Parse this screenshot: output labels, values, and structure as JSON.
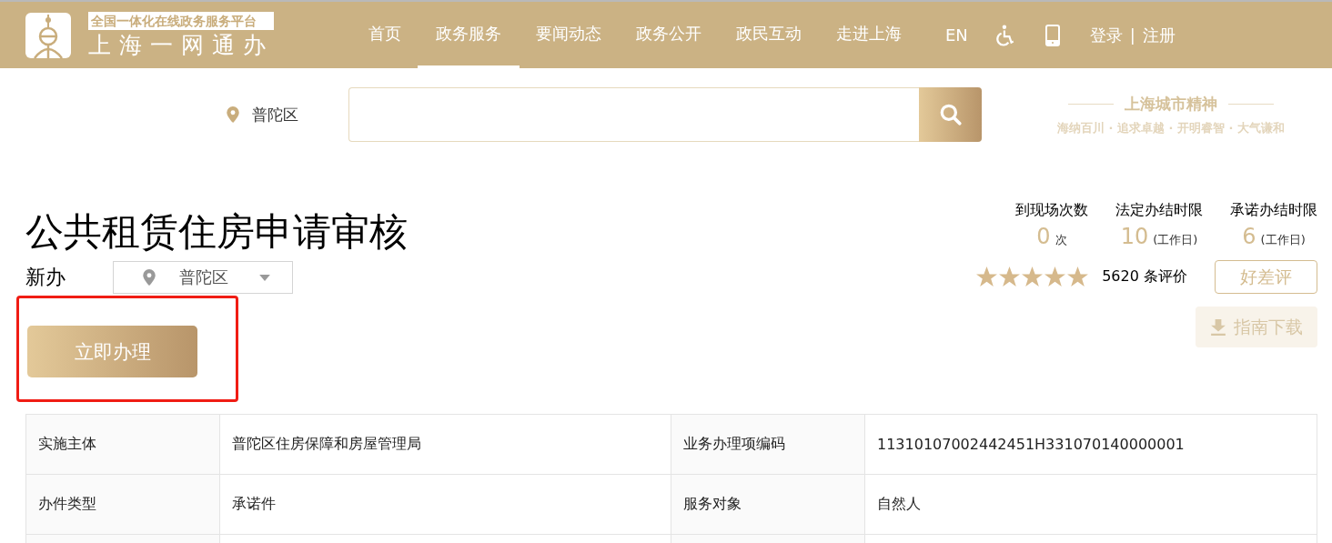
{
  "header": {
    "logo_tagline": "全国一体化在线政务服务平台",
    "logo_title": "上海一网通办",
    "nav": [
      {
        "label": "首页",
        "selected": false
      },
      {
        "label": "政务服务",
        "selected": true
      },
      {
        "label": "要闻动态",
        "selected": false
      },
      {
        "label": "政务公开",
        "selected": false
      },
      {
        "label": "政民互动",
        "selected": false
      },
      {
        "label": "走进上海",
        "selected": false
      }
    ],
    "language": "EN",
    "login": "登录",
    "separator": "|",
    "register": "注册"
  },
  "search": {
    "location": "普陀区"
  },
  "slogan": {
    "title": "上海城市精神",
    "motto": "海纳百川 · 追求卓越 · 开明睿智 · 大气谦和"
  },
  "service": {
    "title": "公共租赁住房申请审核",
    "type": "新办",
    "district": "普陀区",
    "apply_button": "立即办理",
    "highlighted": true
  },
  "stats": [
    {
      "label": "到现场次数",
      "value": "0",
      "unit": "次"
    },
    {
      "label": "法定办结时限",
      "value": "10",
      "unit": "(工作日)"
    },
    {
      "label": "承诺办结时限",
      "value": "6",
      "unit": "(工作日)"
    }
  ],
  "rating": {
    "stars": 5,
    "count": "5620 条评价",
    "review_button": "好差评"
  },
  "guide_button": "指南下载",
  "table": {
    "rows": [
      [
        "实施主体",
        "普陀区住房保障和房屋管理局",
        "业务办理项编码",
        "11310107002442451H331070140000001"
      ],
      [
        "办件类型",
        "承诺件",
        "服务对象",
        "自然人"
      ]
    ]
  }
}
